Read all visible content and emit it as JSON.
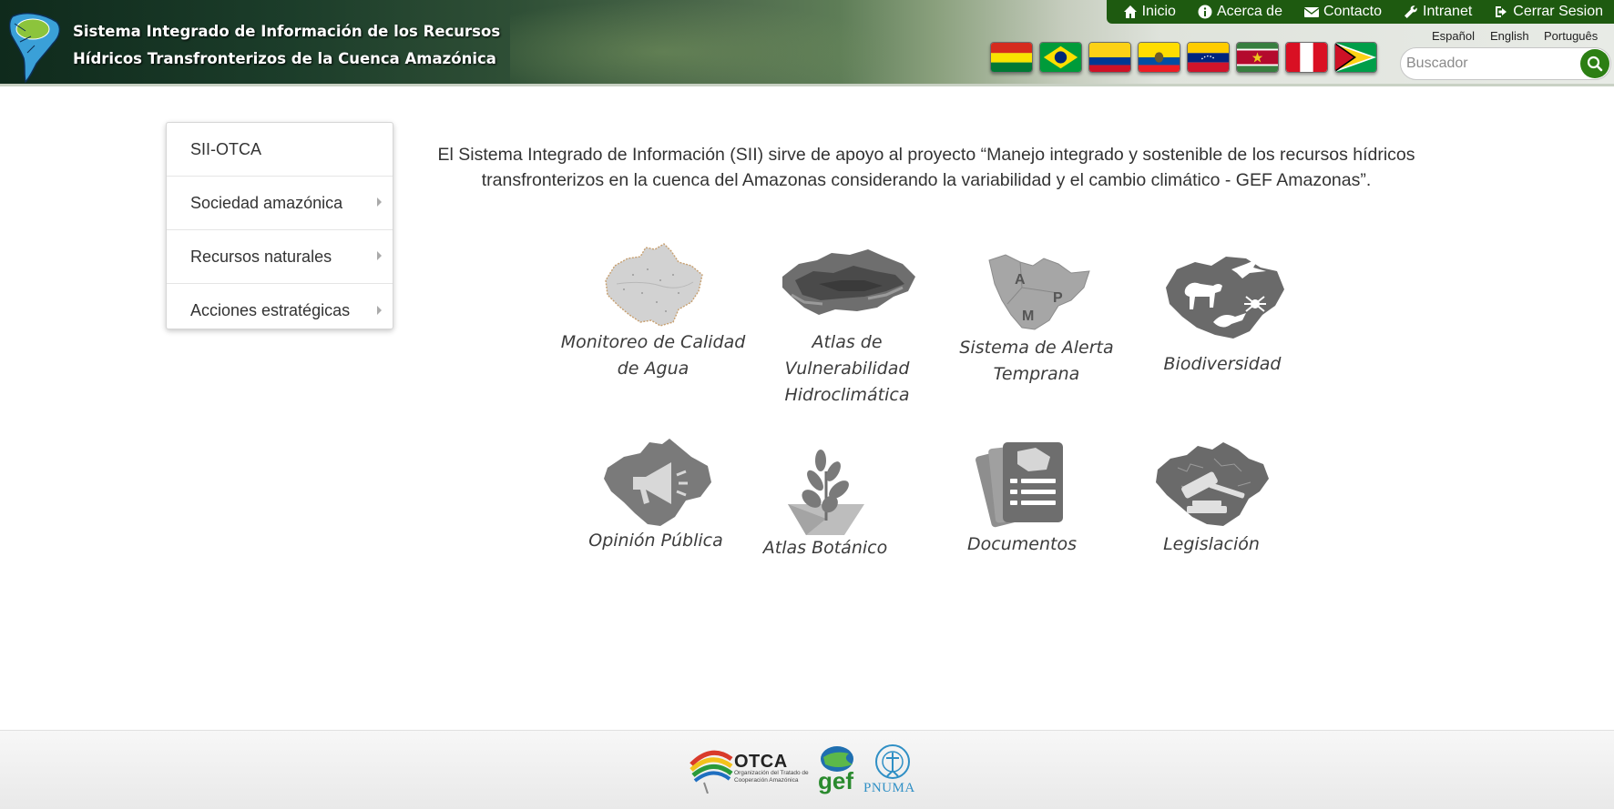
{
  "header": {
    "title_line1": "Sistema Integrado de Información de los Recursos",
    "title_line2": "Hídricos Transfronterizos de la Cuenca Amazónica",
    "nav": [
      {
        "label": "Inicio",
        "icon": "home-icon"
      },
      {
        "label": "Acerca de",
        "icon": "info-icon"
      },
      {
        "label": "Contacto",
        "icon": "envelope-icon"
      },
      {
        "label": "Intranet",
        "icon": "wrench-icon"
      },
      {
        "label": "Cerrar Sesion",
        "icon": "sign-out-icon"
      }
    ],
    "languages": [
      "Español",
      "English",
      "Português"
    ],
    "flags": [
      "bolivia",
      "brasil",
      "colombia",
      "ecuador",
      "venezuela",
      "suriname",
      "peru",
      "guyana"
    ],
    "search": {
      "placeholder": "Buscador"
    }
  },
  "sidebar": {
    "items": [
      {
        "label": "SII-OTCA",
        "submenu": false
      },
      {
        "label": "Sociedad amazónica",
        "submenu": true
      },
      {
        "label": "Recursos naturales",
        "submenu": true
      },
      {
        "label": "Acciones estratégicas",
        "submenu": true
      }
    ]
  },
  "main": {
    "intro": "El Sistema Integrado de Información (SII) sirve de apoyo al proyecto “Manejo integrado y sostenible de los recursos hídricos transfronterizos en la cuenca del Amazonas considerando la variabilidad y el cambio climático - GEF Amazonas”.",
    "tiles": [
      {
        "label": "Monitoreo de Calidad\nde Agua",
        "icon": "water-quality-map-icon"
      },
      {
        "label": "Atlas de Vulnerabilidad\nHidroclimática",
        "icon": "vulnerability-map-icon"
      },
      {
        "label": "Sistema de Alerta\nTemprana",
        "icon": "early-warning-map-icon",
        "map_letters": [
          "A",
          "M",
          "P"
        ]
      },
      {
        "label": "Biodiversidad",
        "icon": "biodiversity-icon"
      },
      {
        "label": "Opinión Pública",
        "icon": "megaphone-map-icon"
      },
      {
        "label": "Atlas Botánico",
        "icon": "plant-icon"
      },
      {
        "label": "Documentos",
        "icon": "documents-icon"
      },
      {
        "label": "Legislación",
        "icon": "gavel-map-icon"
      }
    ]
  },
  "footer": {
    "partners": [
      {
        "name": "OTCA",
        "sub": "Organización del Tratado de Cooperación Amazónica"
      },
      {
        "name": "gef"
      },
      {
        "name": "PNUMA"
      }
    ]
  },
  "colors": {
    "nav_bar": "#1e5a10",
    "search_button": "#2c7f14",
    "icon_gray": "#7a7a7a"
  }
}
